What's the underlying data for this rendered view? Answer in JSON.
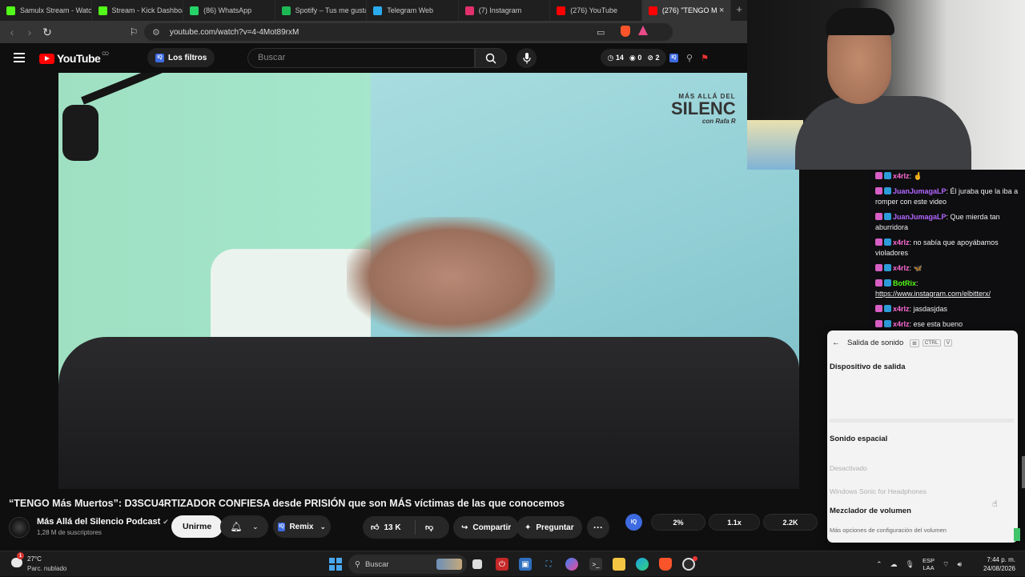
{
  "browser": {
    "tabs": [
      {
        "label": "Samulx Stream - Watch",
        "icon": "kick-icon",
        "color": "#53fc18"
      },
      {
        "label": "Stream - Kick Dashboard",
        "icon": "kick-icon",
        "color": "#53fc18"
      },
      {
        "label": "(86) WhatsApp",
        "icon": "whatsapp-icon",
        "color": "#25d366"
      },
      {
        "label": "Spotify – Tus me gusta",
        "icon": "spotify-icon",
        "color": "#1db954"
      },
      {
        "label": "Telegram Web",
        "icon": "telegram-icon",
        "color": "#2aabee"
      },
      {
        "label": "(7) Instagram",
        "icon": "instagram-icon",
        "color": "#e1306c"
      },
      {
        "label": "(276) YouTube",
        "icon": "youtube-icon",
        "color": "#ff0000"
      },
      {
        "label": "(276) \"TENGO M",
        "icon": "youtube-icon",
        "color": "#ff0000",
        "active": true
      }
    ],
    "url": "youtube.com/watch?v=4-4Mot89rxM"
  },
  "youtube": {
    "logo": "YouTube",
    "region": "CO",
    "filter_chip": "Los filtros",
    "search_placeholder": "Buscar",
    "stats": {
      "clock": "14",
      "views": "0",
      "dislikes": "2"
    }
  },
  "video": {
    "watermark_top": "MÁS ALLÁ DEL",
    "watermark_main": "SILENC",
    "watermark_sub": "con Rafa R",
    "title": "“TENGO Más Muertos”: D3SCU4RTIZADOR CONFIESA desde PRISIÓN que son MÁS víctimas de las que conocemos",
    "channel_name": "Más Allá del Silencio Podcast",
    "subscribers": "1,28 M de suscriptores",
    "join_label": "Unirme",
    "remix_label": "Remix",
    "like_count": "13 K",
    "share_label": "Compartir",
    "ask_label": "Preguntar",
    "extension": {
      "iq": "IQ",
      "pct": "2%",
      "speed": "1.1x",
      "count": "2.2K"
    }
  },
  "chat": {
    "messages": [
      {
        "user": "x4rlz",
        "text": " 🤞",
        "color": "#ff6bd6"
      },
      {
        "user": "JuanJumagaLP",
        "text": " Él juraba que la iba a romper con este video",
        "color": "#b366ff"
      },
      {
        "user": "JuanJumagaLP",
        "text": " Que mierda tan aburridora",
        "color": "#b366ff"
      },
      {
        "user": "x4rlz",
        "text": " no sabía que apoyábamos violadores",
        "color": "#ff6bd6"
      },
      {
        "user": "x4rlz",
        "text": " 🦋",
        "color": "#ff6bd6"
      },
      {
        "user": "BotRix",
        "text": "",
        "link": "https://www.instagram.com/elbitterx/",
        "color": "#53fc18"
      },
      {
        "user": "x4rlz",
        "text": " jasdasjdas",
        "color": "#ff6bd6"
      },
      {
        "user": "x4rlz",
        "text": " ese esta bueno",
        "color": "#ff6bd6"
      }
    ]
  },
  "sound_panel": {
    "title": "Salida de sonido",
    "key1": "CTRL",
    "key2": "V",
    "output_device": "Dispositivo de salida",
    "spatial_sound": "Sonido espacial",
    "option_off": "Desactivado",
    "option_sonic": "Windows Sonic for Headphones",
    "mixer": "Mezclador de volumen",
    "more_options": "Más opciones de configuración del volumen"
  },
  "taskbar": {
    "weather_temp": "27°C",
    "weather_cond": "Parc. nublado",
    "weather_badge": "1",
    "search_placeholder": "Buscar",
    "lang_1": "ESP",
    "lang_2": "LAA",
    "time": "7:44 p. m.",
    "date": "24/08/2026"
  }
}
